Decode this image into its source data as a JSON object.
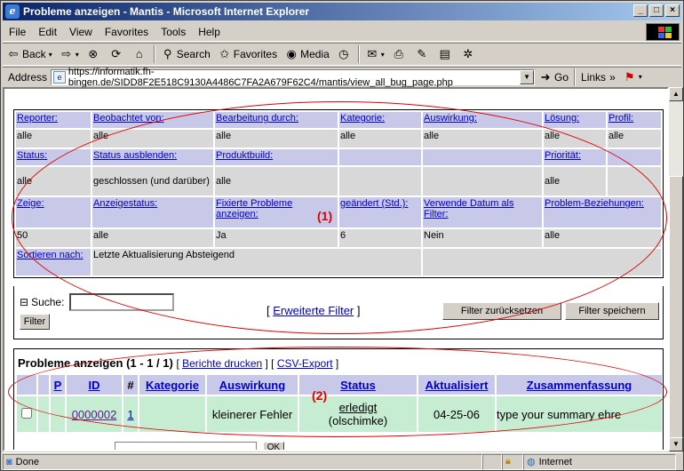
{
  "window": {
    "title": "Probleme anzeigen - Mantis - Microsoft Internet Explorer"
  },
  "menu": [
    "File",
    "Edit",
    "View",
    "Favorites",
    "Tools",
    "Help"
  ],
  "toolbar": {
    "back": "Back",
    "search": "Search",
    "favorites": "Favorites",
    "media": "Media"
  },
  "address": {
    "label": "Address",
    "url": "https://informatik.fh-bingen.de/SIDD8F2E518C9130A4486C7FA2A679F62C4/mantis/view_all_bug_page.php",
    "go": "Go",
    "links": "Links"
  },
  "filters": {
    "row1_headers": [
      "Reporter:",
      "Beobachtet von:",
      "Bearbeitung durch:",
      "Kategorie:",
      "Auswirkung:",
      "Lösung:",
      "Profil:"
    ],
    "row1_values": [
      "alle",
      "alle",
      "alle",
      "alle",
      "alle",
      "alle",
      "alle"
    ],
    "row2_headers": [
      "Status:",
      "Status ausblenden:",
      "Produktbuild:",
      "",
      "",
      "Priorität:",
      ""
    ],
    "row2_values": [
      "alle",
      "geschlossen (und darüber)",
      "alle",
      "",
      "",
      "alle",
      ""
    ],
    "row3_headers": [
      "Zeige:",
      "Anzeigestatus:",
      "Fixierte Probleme anzeigen:",
      "geändert (Std.):",
      "Verwende Datum als Filter:",
      "Problem-Beziehungen:"
    ],
    "row3_values": [
      "50",
      "alle",
      "Ja",
      "6",
      "Nein",
      "alle"
    ],
    "sort_label": "Sortieren nach:",
    "sort_value": "Letzte Aktualisierung Absteigend",
    "search_label": "Suche:",
    "search_value": "",
    "filter_button": "Filter",
    "advanced": "Erweiterte Filter",
    "reset_button": "Filter zurücksetzen",
    "save_button": "Filter speichern"
  },
  "results": {
    "title": "Probleme anzeigen (1 - 1 / 1)",
    "print_link": "Berichte drucken",
    "csv_link": "CSV-Export",
    "columns": [
      "",
      "",
      "P",
      "ID",
      "#",
      "Kategorie",
      "Auswirkung",
      "Status",
      "Aktualisiert",
      "Zusammenfassung"
    ],
    "row": {
      "id": "0000002",
      "count": "1",
      "category": "",
      "severity": "kleinerer Fehler",
      "status": "erledigt",
      "handler": "(olschimke)",
      "updated": "04-25-06",
      "summary": "type your summary ehre"
    },
    "ok_button": "OK"
  },
  "annotations": {
    "a1": "(1)",
    "a2": "(2)"
  },
  "status": {
    "text": "Done",
    "zone": "Internet"
  },
  "colors": {
    "header_bg": "#c8c8e8",
    "value_bg": "#d8d8d8",
    "row_bg": "#c6ecd2",
    "annotation": "#e00000",
    "link": "#0000cc"
  }
}
